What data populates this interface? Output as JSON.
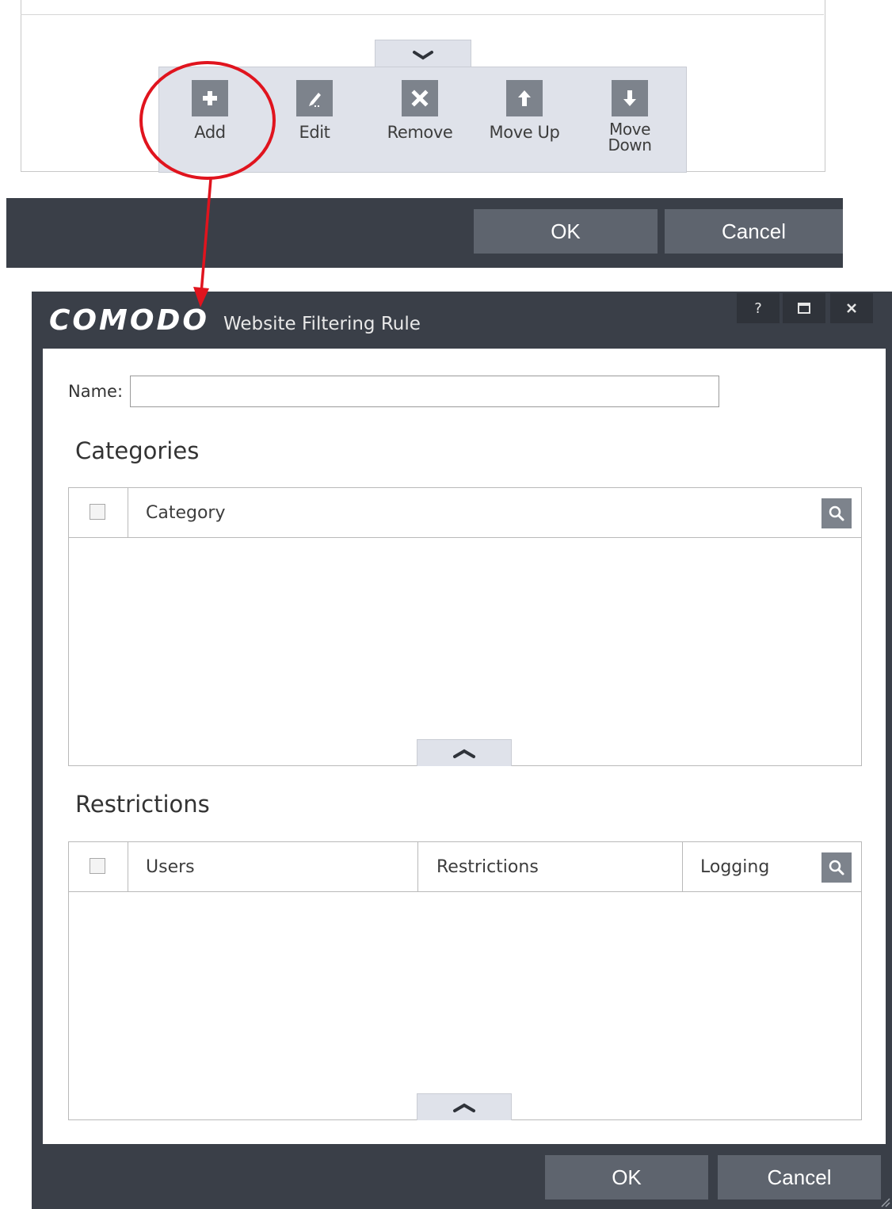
{
  "parent": {
    "toolbar": {
      "items": [
        {
          "label": "Add",
          "icon": "plus-icon"
        },
        {
          "label": "Edit",
          "icon": "edit-icon"
        },
        {
          "label": "Remove",
          "icon": "remove-icon"
        },
        {
          "label": "Move Up",
          "icon": "arrow-up-icon"
        },
        {
          "label": "Move Down",
          "label_line1": "Move",
          "label_line2": "Down",
          "icon": "arrow-down-icon"
        }
      ]
    },
    "ok_label": "OK",
    "cancel_label": "Cancel"
  },
  "dialog": {
    "brand": "COMODO",
    "title": "Website Filtering Rule",
    "window_controls": [
      "?",
      "□",
      "×"
    ],
    "name_label": "Name:",
    "name_value": "",
    "categories": {
      "title": "Categories",
      "columns": [
        "Category"
      ]
    },
    "restrictions": {
      "title": "Restrictions",
      "columns": [
        "Users",
        "Restrictions",
        "Logging"
      ]
    },
    "ok_label": "OK",
    "cancel_label": "Cancel"
  },
  "colors": {
    "dark_frame": "#3a3f48",
    "button": "#5e646e",
    "toolbar_bg": "#dfe2ea",
    "icon_bg": "#7d838c",
    "annotation": "#e0141e"
  }
}
